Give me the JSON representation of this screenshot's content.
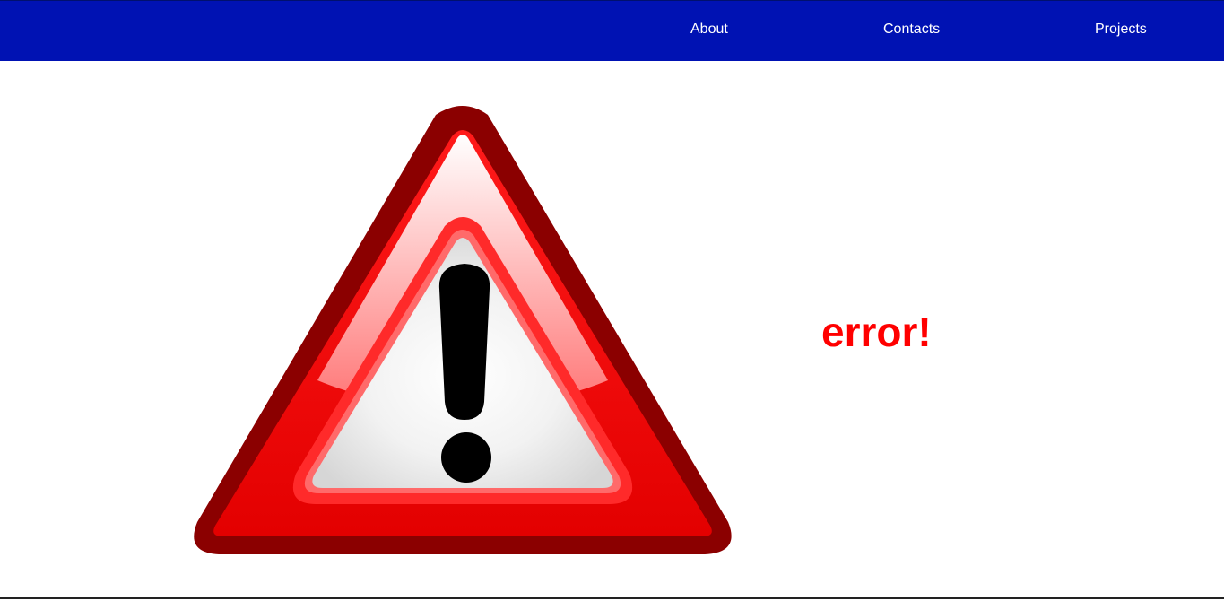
{
  "nav": {
    "items": [
      {
        "label": "About"
      },
      {
        "label": "Contacts"
      },
      {
        "label": "Projects"
      }
    ]
  },
  "main": {
    "graphic_icon": "warning-exclamation-triangle-icon",
    "message": "error!"
  },
  "colors": {
    "navbar_bg": "#0012b3",
    "nav_text": "#ffffff",
    "error_text": "#ff0000",
    "triangle_outer": "#8b0000",
    "triangle_red": "#ff0000",
    "exclamation": "#000000"
  }
}
